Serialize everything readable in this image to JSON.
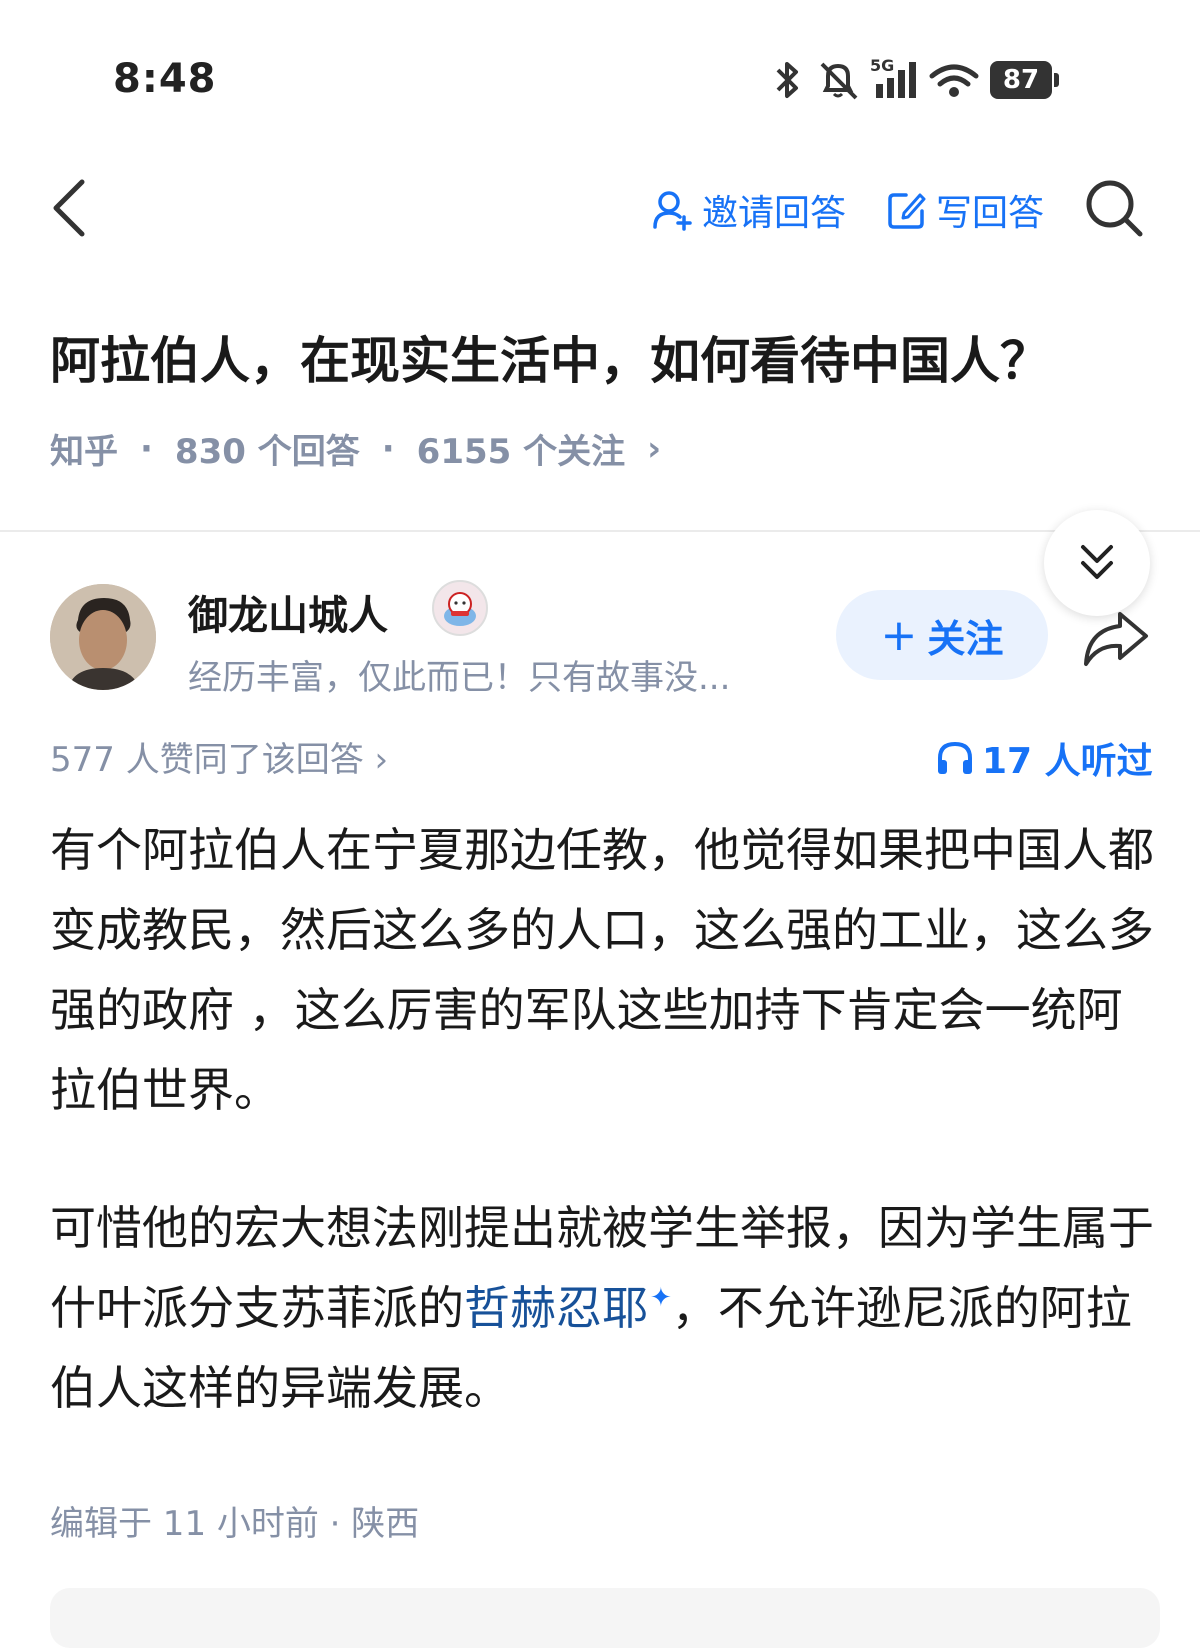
{
  "status_bar": {
    "time": "8:48",
    "network": "5G",
    "battery": "87"
  },
  "header": {
    "back_icon": "chevron-left-icon",
    "invite_label": "邀请回答",
    "write_label": "写回答",
    "search_icon": "search-icon"
  },
  "question": {
    "title": "阿拉伯人，在现实生活中，如何看待中国人？",
    "source": "知乎",
    "sep1": "·",
    "answers": "830 个回答",
    "sep2": "·",
    "followers": "6155 个关注",
    "more": "›"
  },
  "answer": {
    "author_name": "御龙山城人",
    "author_bio": "经历丰富，仅此而已！只有故事没...",
    "follow_plus": "+",
    "follow_label": "关注",
    "upvotes": "577 人赞同了该回答 ›",
    "listened": "17 人听过",
    "paragraph1": "有个阿拉伯人在宁夏那边任教，他觉得如果把中国人都变成教民，然后这么多的人口，这么强的工业，这么多强的政府 ，这么厉害的军队这些加持下肯定会一统阿拉伯世界。",
    "paragraph2_before": "可惜他的宏大想法刚提出就被学生举报，因为学生属于什叶派分支苏菲派的",
    "paragraph2_link": "哲赫忍耶",
    "paragraph2_spark": "✦",
    "paragraph2_after": "，不允许逊尼派的阿拉伯人这样的异端发展。",
    "edited": "编辑于 11 小时前 · 陕西"
  },
  "colors": {
    "accent": "#1772f6",
    "link": "#175199",
    "muted": "#8590a6"
  }
}
